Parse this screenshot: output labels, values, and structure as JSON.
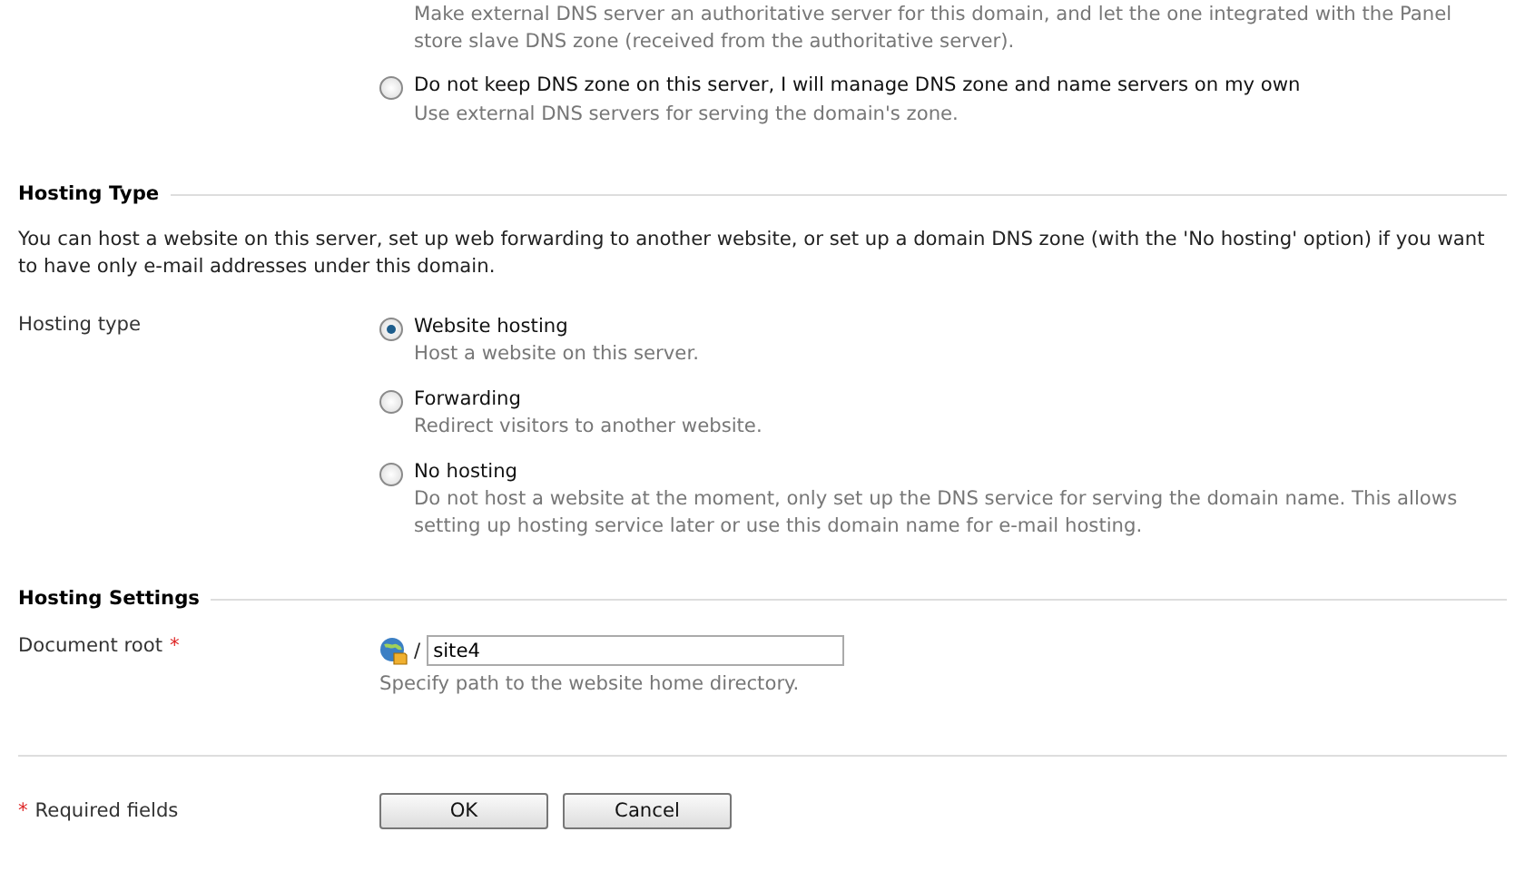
{
  "dns_options": [
    {
      "description": "Make external DNS server an authoritative server for this domain, and let the one integrated with the Panel store slave DNS zone (received from the authoritative server)."
    },
    {
      "label": "Do not keep DNS zone on this server, I will manage DNS zone and name servers on my own",
      "description": "Use external DNS servers for serving the domain's zone.",
      "selected": false
    }
  ],
  "hosting_type": {
    "title": "Hosting Type",
    "intro": "You can host a website on this server, set up web forwarding to another website, or set up a domain DNS zone (with the 'No hosting' option) if you want to have only e-mail addresses under this domain.",
    "field_label": "Hosting type",
    "options": [
      {
        "label": "Website hosting",
        "description": "Host a website on this server.",
        "selected": true
      },
      {
        "label": "Forwarding",
        "description": "Redirect visitors to another website.",
        "selected": false
      },
      {
        "label": "No hosting",
        "description": "Do not host a website at the moment, only set up the DNS service for serving the domain name. This allows setting up hosting service later or use this domain name for e-mail hosting.",
        "selected": false
      }
    ]
  },
  "hosting_settings": {
    "title": "Hosting Settings",
    "field_label": "Document root",
    "required_mark": "*",
    "separator": "/",
    "value": "site4",
    "hint": "Specify path to the website home directory."
  },
  "footer": {
    "required_mark": "*",
    "required_label": "Required fields",
    "buttons": [
      "OK",
      "Cancel"
    ]
  }
}
